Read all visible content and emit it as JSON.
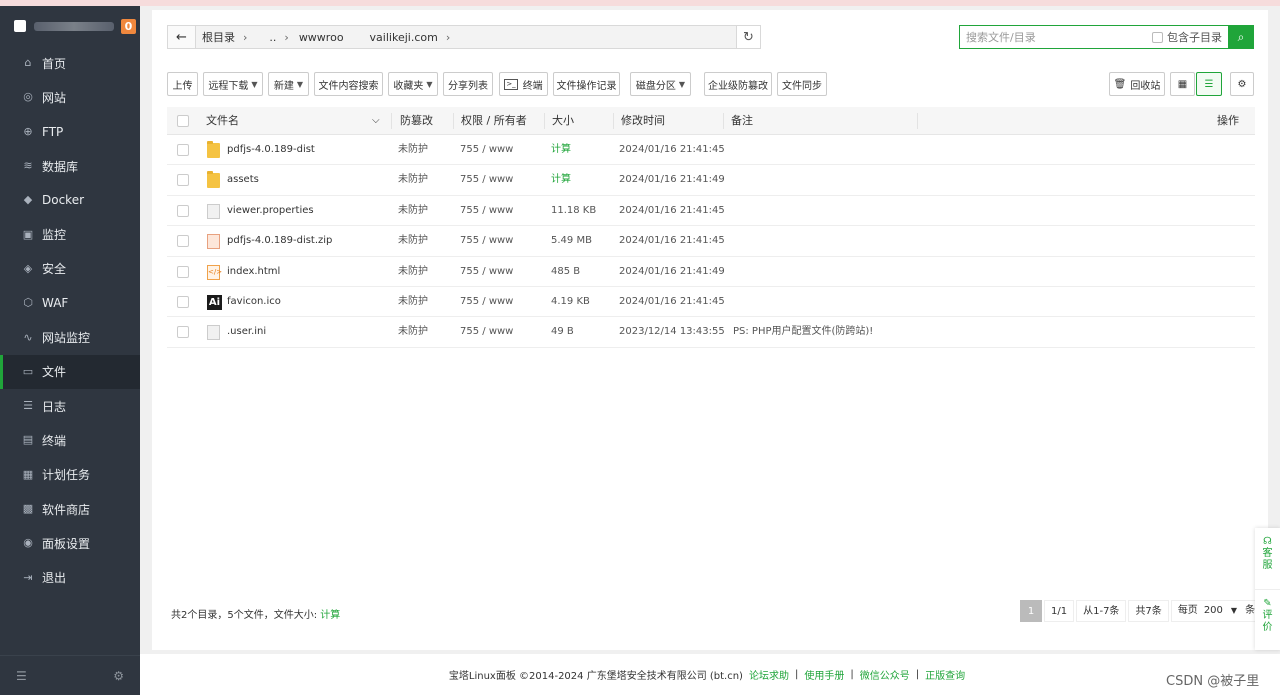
{
  "sidebar": {
    "badge": "0",
    "items": [
      {
        "label": "首页",
        "icon": "home-icon"
      },
      {
        "label": "网站",
        "icon": "globe-icon"
      },
      {
        "label": "FTP",
        "icon": "ftp-icon"
      },
      {
        "label": "数据库",
        "icon": "database-icon"
      },
      {
        "label": "Docker",
        "icon": "docker-icon"
      },
      {
        "label": "监控",
        "icon": "monitor-icon"
      },
      {
        "label": "安全",
        "icon": "shield-icon"
      },
      {
        "label": "WAF",
        "icon": "waf-icon"
      },
      {
        "label": "网站监控",
        "icon": "chart-icon"
      },
      {
        "label": "文件",
        "icon": "folder-icon",
        "active": true
      },
      {
        "label": "日志",
        "icon": "log-icon"
      },
      {
        "label": "终端",
        "icon": "terminal-icon"
      },
      {
        "label": "计划任务",
        "icon": "task-icon"
      },
      {
        "label": "软件商店",
        "icon": "store-icon"
      },
      {
        "label": "面板设置",
        "icon": "settings-icon"
      },
      {
        "label": "退出",
        "icon": "logout-icon"
      }
    ]
  },
  "path": {
    "root": "根目录",
    "seg1": "..",
    "seg2": "wwwroo",
    "seg3": "vailikeji.com"
  },
  "search": {
    "placeholder": "搜索文件/目录",
    "include_sub": "包含子目录"
  },
  "toolbar": {
    "upload": "上传",
    "remote_download": "远程下载",
    "new": "新建",
    "content_search": "文件内容搜索",
    "favorites": "收藏夹",
    "share_list": "分享列表",
    "terminal": "终端",
    "operation_log": "文件操作记录",
    "disk_partition": "磁盘分区",
    "tamper_proof": "企业级防篡改",
    "file_sync": "文件同步",
    "recycle_bin": "回收站"
  },
  "table": {
    "headers": {
      "name": "文件名",
      "tamper": "防篡改",
      "perm": "权限 / 所有者",
      "size": "大小",
      "mtime": "修改时间",
      "remark": "备注",
      "ops": "操作"
    },
    "rows": [
      {
        "name": "pdfjs-4.0.189-dist",
        "type": "folder",
        "tamper": "未防护",
        "perm": "755 / www",
        "size": "计算",
        "mtime": "2024/01/16 21:41:45",
        "remark": ""
      },
      {
        "name": "assets",
        "type": "folder",
        "tamper": "未防护",
        "perm": "755 / www",
        "size": "计算",
        "mtime": "2024/01/16 21:41:49",
        "remark": ""
      },
      {
        "name": "viewer.properties",
        "type": "doc",
        "tamper": "未防护",
        "perm": "755 / www",
        "size": "11.18 KB",
        "mtime": "2024/01/16 21:41:45",
        "remark": ""
      },
      {
        "name": "pdfjs-4.0.189-dist.zip",
        "type": "zip",
        "tamper": "未防护",
        "perm": "755 / www",
        "size": "5.49 MB",
        "mtime": "2024/01/16 21:41:45",
        "remark": ""
      },
      {
        "name": "index.html",
        "type": "html",
        "tamper": "未防护",
        "perm": "755 / www",
        "size": "485 B",
        "mtime": "2024/01/16 21:41:49",
        "remark": ""
      },
      {
        "name": "favicon.ico",
        "type": "ai",
        "tamper": "未防护",
        "perm": "755 / www",
        "size": "4.19 KB",
        "mtime": "2024/01/16 21:41:45",
        "remark": ""
      },
      {
        "name": ".user.ini",
        "type": "doc",
        "tamper": "未防护",
        "perm": "755 / www",
        "size": "49 B",
        "mtime": "2023/12/14 13:43:55",
        "remark": "PS: PHP用户配置文件(防跨站)!"
      }
    ]
  },
  "summary": {
    "text": "共2个目录，5个文件，文件大小:",
    "calc": "计算"
  },
  "pager": {
    "current": "1",
    "pages": "1/1",
    "range": "从1-7条",
    "total": "共7条",
    "per_page_label": "每页",
    "per_page": "200",
    "unit": "条"
  },
  "footer": {
    "copyright": "宝塔Linux面板 ©2014-2024 广东堡塔安全技术有限公司 (bt.cn)",
    "links": [
      "论坛求助",
      "使用手册",
      "微信公众号",
      "正版查询"
    ]
  },
  "float": {
    "service": "客服",
    "review": "评价"
  },
  "watermark": "CSDN @被子里",
  "colors": {
    "accent": "#20a53a",
    "sidebar_bg": "#2f3640"
  }
}
